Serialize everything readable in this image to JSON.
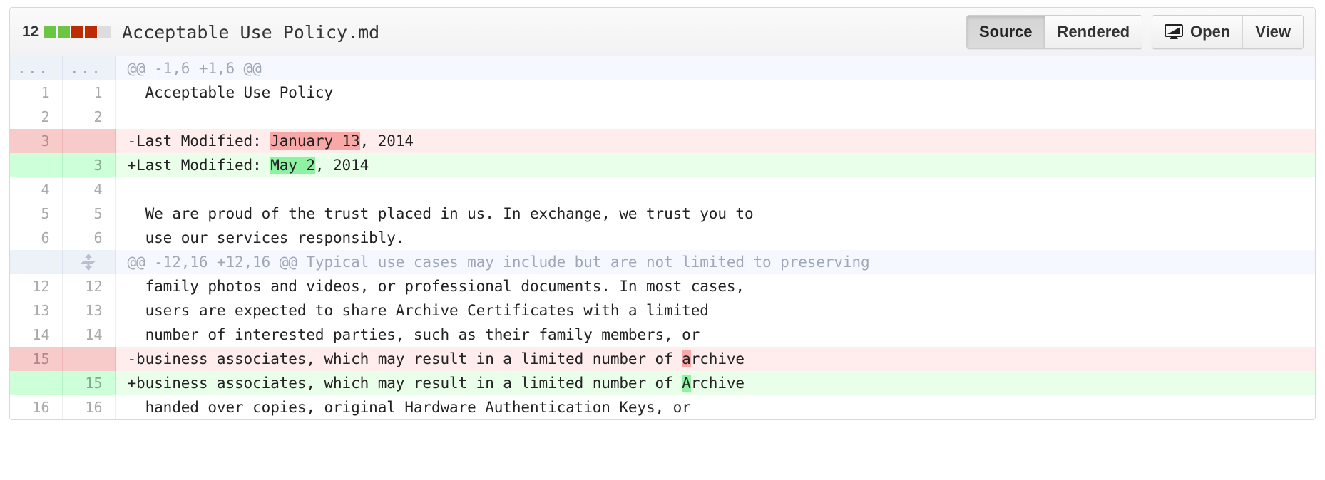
{
  "header": {
    "diffstat_count": "12",
    "diffstat_blocks": [
      "add",
      "add",
      "del",
      "del",
      "none"
    ],
    "file_name": "Acceptable Use Policy.md",
    "buttons": {
      "source_label": "Source",
      "rendered_label": "Rendered",
      "open_label": "Open",
      "view_label": "View",
      "open_icon": "monitor-icon",
      "selected": "Source"
    }
  },
  "colors": {
    "diffstat_add": "#6cc644",
    "diffstat_del": "#bd2c00",
    "diffstat_none": "#dddddd",
    "row_del_bg": "#ffecec",
    "row_add_bg": "#eaffea",
    "row_del_gutter": "#f8cbcb",
    "row_add_gutter": "#cdffd8",
    "word_del_bg": "#f9a8a8",
    "word_add_bg": "#8ef2a2",
    "hunk_bg": "#f6f8ff"
  },
  "diff": {
    "rows": [
      {
        "type": "hunk",
        "old_ln": "...",
        "new_ln": "...",
        "expander": false,
        "code": "@@ -1,6 +1,6 @@"
      },
      {
        "type": "ctx",
        "old_ln": "1",
        "new_ln": "1",
        "code": "  Acceptable Use Policy"
      },
      {
        "type": "ctx",
        "old_ln": "2",
        "new_ln": "2",
        "code": "  "
      },
      {
        "type": "del",
        "old_ln": "3",
        "new_ln": "",
        "code_pre": "-Last Modified: ",
        "code_hl": "January 13",
        "code_post": ", 2014"
      },
      {
        "type": "add",
        "old_ln": "",
        "new_ln": "3",
        "code_pre": "+Last Modified: ",
        "code_hl": "May 2",
        "code_post": ", 2014"
      },
      {
        "type": "ctx",
        "old_ln": "4",
        "new_ln": "4",
        "code": "  "
      },
      {
        "type": "ctx",
        "old_ln": "5",
        "new_ln": "5",
        "code": "  We are proud of the trust placed in us. In exchange, we trust you to"
      },
      {
        "type": "ctx",
        "old_ln": "6",
        "new_ln": "6",
        "code": "  use our services responsibly."
      },
      {
        "type": "hunk",
        "old_ln": "",
        "new_ln": "",
        "expander": true,
        "expander_icon": "unfold-icon",
        "code": "@@ -12,16 +12,16 @@ Typical use cases may include but are not limited to preserving"
      },
      {
        "type": "ctx",
        "old_ln": "12",
        "new_ln": "12",
        "code": "  family photos and videos, or professional documents. In most cases,"
      },
      {
        "type": "ctx",
        "old_ln": "13",
        "new_ln": "13",
        "code": "  users are expected to share Archive Certificates with a limited"
      },
      {
        "type": "ctx",
        "old_ln": "14",
        "new_ln": "14",
        "code": "  number of interested parties, such as their family members, or"
      },
      {
        "type": "del",
        "old_ln": "15",
        "new_ln": "",
        "code_pre": "-business associates, which may result in a limited number of ",
        "code_hl": "a",
        "code_post": "rchive"
      },
      {
        "type": "add",
        "old_ln": "",
        "new_ln": "15",
        "code_pre": "+business associates, which may result in a limited number of ",
        "code_hl": "A",
        "code_post": "rchive"
      },
      {
        "type": "ctx",
        "old_ln": "16",
        "new_ln": "16",
        "code": "  handed over copies, original Hardware Authentication Keys, or"
      }
    ]
  }
}
